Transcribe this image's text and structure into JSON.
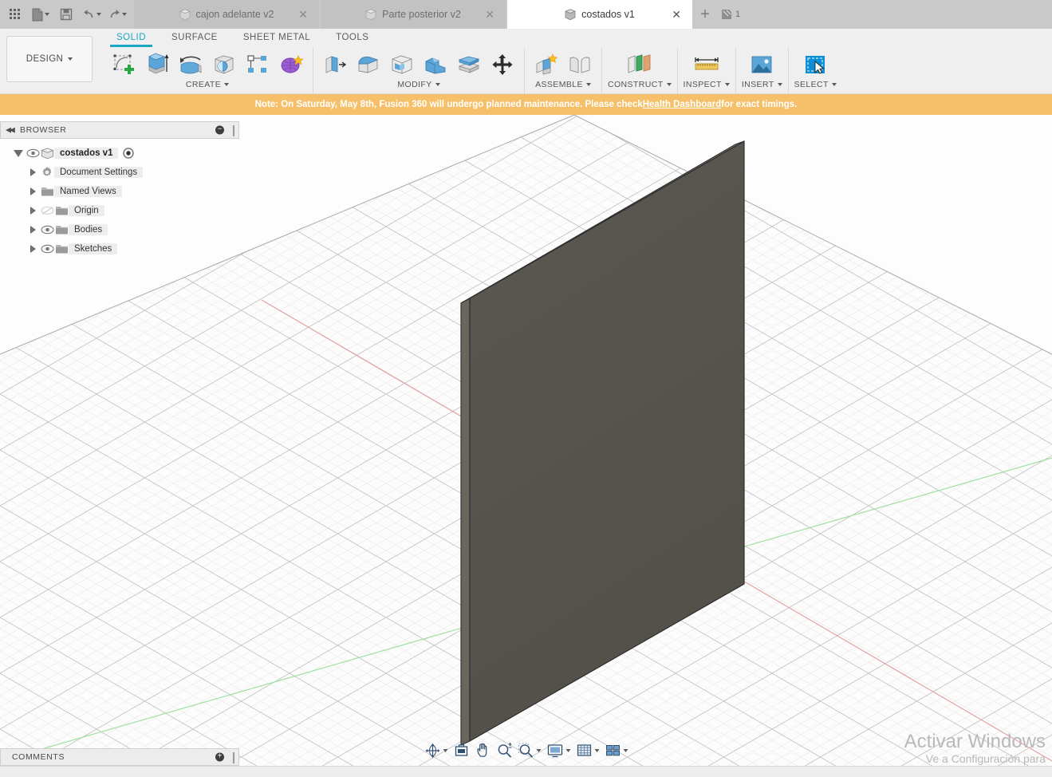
{
  "window": {
    "app": "Fusion 360",
    "quick_access": [
      {
        "name": "apps-grid-icon",
        "label": "Apps"
      },
      {
        "name": "new-file-icon",
        "label": "File"
      },
      {
        "name": "save-icon",
        "label": "Save"
      },
      {
        "name": "undo-icon",
        "label": "Undo"
      },
      {
        "name": "redo-icon",
        "label": "Redo"
      }
    ],
    "tabs": [
      {
        "label": "cajon adelante v2",
        "active": false,
        "close": "✕"
      },
      {
        "label": "Parte posterior v2",
        "active": false,
        "close": "✕"
      },
      {
        "label": "costados v1",
        "active": true,
        "close": "✕"
      }
    ],
    "new_tab_label": "+",
    "extra_tab_count": "1"
  },
  "ribbon": {
    "workspace_label": "DESIGN",
    "tabs": [
      {
        "label": "SOLID",
        "active": true
      },
      {
        "label": "SURFACE",
        "active": false
      },
      {
        "label": "SHEET METAL",
        "active": false
      },
      {
        "label": "TOOLS",
        "active": false
      }
    ],
    "panels": [
      {
        "label": "CREATE",
        "has_dropdown": true,
        "tools": [
          "sketch-icon",
          "extrude-icon",
          "revolve-icon",
          "sphere-icon",
          "pattern-icon",
          "create-form-icon"
        ]
      },
      {
        "label": "MODIFY",
        "has_dropdown": true,
        "tools": [
          "press-pull-icon",
          "fillet-icon",
          "shell-icon",
          "combine-icon",
          "offset-face-icon",
          "move-copy-icon"
        ]
      },
      {
        "label": "ASSEMBLE",
        "has_dropdown": true,
        "tools": [
          "new-component-icon",
          "joint-icon"
        ]
      },
      {
        "label": "CONSTRUCT",
        "has_dropdown": true,
        "tools": [
          "offset-plane-icon"
        ]
      },
      {
        "label": "INSPECT",
        "has_dropdown": true,
        "tools": [
          "measure-icon"
        ]
      },
      {
        "label": "INSERT",
        "has_dropdown": true,
        "tools": [
          "insert-image-icon"
        ]
      },
      {
        "label": "SELECT",
        "has_dropdown": true,
        "tools": [
          "select-window-icon"
        ]
      }
    ]
  },
  "banner": {
    "prefix": "Note: On Saturday, May 8th, Fusion 360 will undergo planned maintenance. Please check ",
    "link": "Health Dashboard",
    "suffix": " for exact timings.",
    "background": "#f6c06a",
    "text_color": "#ffffff"
  },
  "browser": {
    "title": "BROWSER",
    "collapse_icon": "◀◀",
    "minimize_icon": "−",
    "tree": [
      {
        "label": "costados v1",
        "depth": 0,
        "expanded": true,
        "root": true,
        "eye": true,
        "icon": "component-cube-icon",
        "extra": "radio-dot-icon"
      },
      {
        "label": "Document Settings",
        "depth": 1,
        "expanded": false,
        "root": false,
        "eye": false,
        "icon": "gear-icon"
      },
      {
        "label": "Named Views",
        "depth": 1,
        "expanded": false,
        "root": false,
        "eye": false,
        "icon": "folder-icon"
      },
      {
        "label": "Origin",
        "depth": 1,
        "expanded": false,
        "root": false,
        "eye": true,
        "eye_off": true,
        "icon": "folder-icon"
      },
      {
        "label": "Bodies",
        "depth": 1,
        "expanded": false,
        "root": false,
        "eye": true,
        "icon": "folder-icon"
      },
      {
        "label": "Sketches",
        "depth": 1,
        "expanded": false,
        "root": false,
        "eye": true,
        "icon": "folder-icon"
      }
    ]
  },
  "comments": {
    "title": "COMMENTS",
    "add_icon": "+"
  },
  "navbar": {
    "items": [
      {
        "name": "orbit-icon",
        "dropdown": true
      },
      {
        "name": "look-at-icon",
        "dropdown": false
      },
      {
        "name": "pan-icon",
        "dropdown": false
      },
      {
        "name": "zoom-icon",
        "dropdown": false
      },
      {
        "name": "fit-icon",
        "dropdown": true
      },
      {
        "name": "display-settings-icon",
        "dropdown": true
      },
      {
        "name": "grid-snaps-icon",
        "dropdown": true
      },
      {
        "name": "viewports-icon",
        "dropdown": true
      }
    ]
  },
  "viewport": {
    "background": "#fdfdfd",
    "grid_color": "#d8d8d8",
    "grid_minor_color": "#ececec",
    "x_axis_color": "#e8a0a0",
    "y_axis_color": "#9fe0a0",
    "body": {
      "name": "costados panel",
      "face_color": "#57544d",
      "top_edge_color": "#6e6b63",
      "side_edge_color": "#6b675f",
      "outline_color": "#2b2b2b"
    }
  },
  "watermark": {
    "line1": "Activar Windows",
    "line2": "Ve a Configuración para"
  }
}
